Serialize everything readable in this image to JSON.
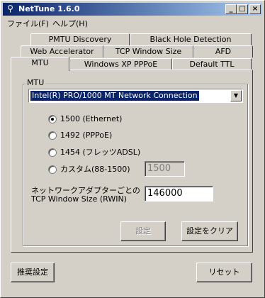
{
  "window": {
    "title": "NetTune 1.6.0"
  },
  "menu": [
    {
      "label": "ファイル(F)"
    },
    {
      "label": "ヘルプ(H)"
    }
  ],
  "tabs": {
    "row1": [
      "PMTU Discovery",
      "Black Hole Detection"
    ],
    "row2": [
      "Web Accelerator",
      "TCP Window Size",
      "AFD"
    ],
    "row3": [
      "MTU",
      "Windows XP PPPoE",
      "Default TTL"
    ],
    "active": "MTU"
  },
  "mtu": {
    "group_label": "MTU",
    "adapter_selected": "Intel(R) PRO/1000 MT Network Connection",
    "options": [
      {
        "label": "1500 (Ethernet)",
        "checked": true
      },
      {
        "label": "1492 (PPPoE)",
        "checked": false
      },
      {
        "label": "1454 (フレッツADSL)",
        "checked": false
      },
      {
        "label": "カスタム(88-1500)",
        "checked": false
      }
    ],
    "custom_value": "1500",
    "tcp_window_label_line1": "ネットワークアダプターごとの",
    "tcp_window_label_line2": "TCP Window Size (RWIN)",
    "tcp_window_value": "146000",
    "apply_label": "設定",
    "clear_label": "設定をクリア"
  },
  "footer": {
    "recommended_label": "推奨設定",
    "reset_label": "リセット"
  }
}
